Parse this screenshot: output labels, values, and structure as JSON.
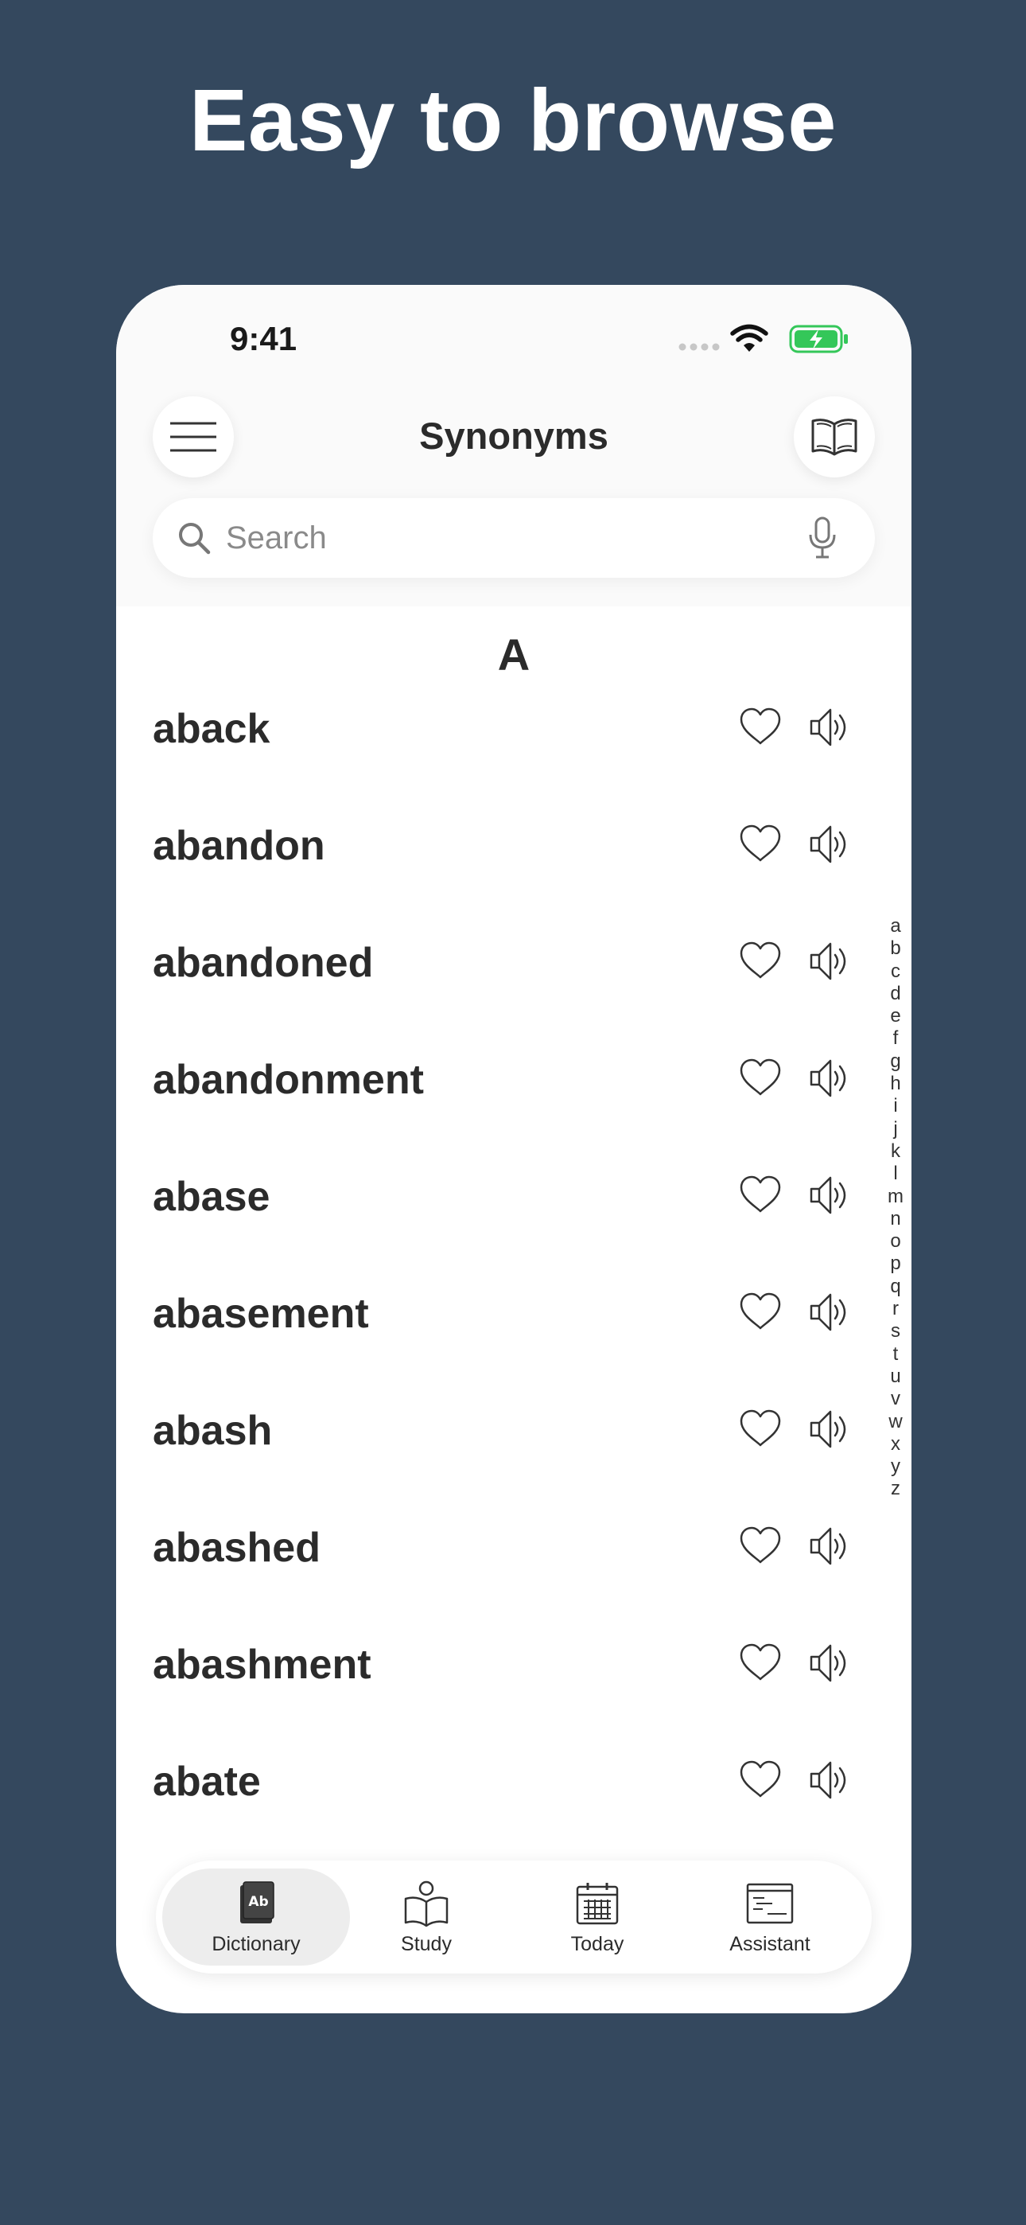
{
  "headline": "Easy to browse",
  "status": {
    "time": "9:41"
  },
  "header": {
    "title": "Synonyms"
  },
  "search": {
    "placeholder": "Search"
  },
  "section": "A",
  "words": [
    "aback",
    "abandon",
    "abandoned",
    "abandonment",
    "abase",
    "abasement",
    "abash",
    "abashed",
    "abashment",
    "abate"
  ],
  "alphabet": [
    "a",
    "b",
    "c",
    "d",
    "e",
    "f",
    "g",
    "h",
    "i",
    "j",
    "k",
    "l",
    "m",
    "n",
    "o",
    "p",
    "q",
    "r",
    "s",
    "t",
    "u",
    "v",
    "w",
    "x",
    "y",
    "z"
  ],
  "tabs": [
    {
      "label": "Dictionary",
      "icon": "dictionary-book-icon",
      "active": true
    },
    {
      "label": "Study",
      "icon": "reading-person-icon",
      "active": false
    },
    {
      "label": "Today",
      "icon": "calendar-icon",
      "active": false
    },
    {
      "label": "Assistant",
      "icon": "assistant-window-icon",
      "active": false
    }
  ],
  "tab_icon_text": "Ab",
  "colors": {
    "background": "#34485e",
    "battery": "#34c759",
    "text": "#2b2b2b"
  }
}
